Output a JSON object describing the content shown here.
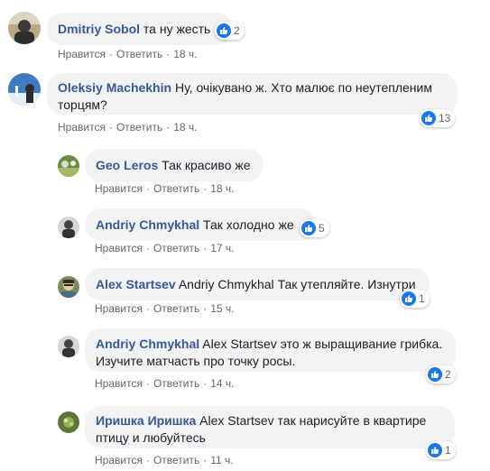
{
  "icons": {
    "like": "thumbs-up-icon"
  },
  "colors": {
    "name": "#385898",
    "bubble": "#f2f3f5",
    "like": "#1877f2",
    "meta": "#606770"
  },
  "comments": [
    {
      "author": "Dmitriy Sobol",
      "tag": "",
      "text": "та ну жесть",
      "reactions": "2",
      "like": "Нравится",
      "reply": "Ответить",
      "time": "18 ч."
    },
    {
      "author": "Oleksiy Machekhin",
      "tag": "",
      "text": "Ну, очікувано ж. Хто малює по неутепленим торцям?",
      "reactions": "13",
      "like": "Нравится",
      "reply": "Ответить",
      "time": "18 ч."
    },
    {
      "author": "Geo Leros",
      "tag": "",
      "text": "Так красиво же",
      "reactions": "",
      "like": "Нравится",
      "reply": "Ответить",
      "time": "18 ч."
    },
    {
      "author": "Andriy Chmykhal",
      "tag": "",
      "text": "Так холодно же",
      "reactions": "5",
      "like": "Нравится",
      "reply": "Ответить",
      "time": "17 ч."
    },
    {
      "author": "Alex Startsev",
      "tag": "Andriy Chmykhal",
      "text": "Так утепляйте. Изнутри",
      "reactions": "1",
      "like": "Нравится",
      "reply": "Ответить",
      "time": "15 ч."
    },
    {
      "author": "Andriy Chmykhal",
      "tag": "Alex Startsev",
      "text": "это ж выращивание грибка. Изучите матчасть про точку росы.",
      "reactions": "2",
      "like": "Нравится",
      "reply": "Ответить",
      "time": "14 ч."
    },
    {
      "author": "Иришка Иришка",
      "tag": "Alex Startsev",
      "text": "так нарисуйте в квартире птицу и любуйтесь",
      "reactions": "1",
      "like": "Нравится",
      "reply": "Ответить",
      "time": "11 ч."
    }
  ]
}
